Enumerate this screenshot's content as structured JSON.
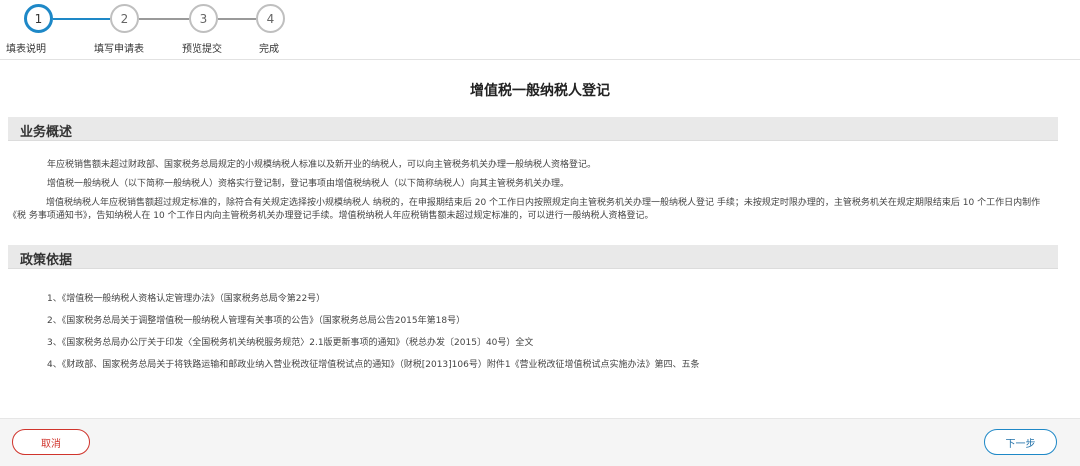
{
  "stepper": {
    "steps": [
      {
        "number": "1",
        "label": "填表说明"
      },
      {
        "number": "2",
        "label": "填写申请表"
      },
      {
        "number": "3",
        "label": "预览提交"
      },
      {
        "number": "4",
        "label": "完成"
      }
    ],
    "active_step": 1
  },
  "page": {
    "title": "增值税一般纳税人登记"
  },
  "overview": {
    "heading": "业务概述",
    "paragraphs": [
      "年应税销售额未超过财政部、国家税务总局规定的小规模纳税人标准以及新开业的纳税人，可以向主管税务机关办理一般纳税人资格登记。",
      "增值税一般纳税人（以下简称一般纳税人）资格实行登记制，登记事项由增值税纳税人（以下简称纳税人）向其主管税务机关办理。",
      "增值税纳税人年应税销售额超过规定标准的，除符合有关规定选择按小规模纳税人 纳税的，在申报期结束后 20 个工作日内按照规定向主管税务机关办理一般纳税人登记 手续；未按规定时限办理的，主管税务机关在规定期限结束后 10 个工作日内制作《税 务事项通知书》，告知纳税人在 10 个工作日内向主管税务机关办理登记手续。增值税纳税人年应税销售额未超过规定标准的，可以进行一般纳税人资格登记。"
    ]
  },
  "policy": {
    "heading": "政策依据",
    "items": [
      "1、《增值税一般纳税人资格认定管理办法》（国家税务总局令第22号）",
      "2、《国家税务总局关于调整增值税一般纳税人管理有关事项的公告》（国家税务总局公告2015年第18号）",
      "3、《国家税务总局办公厅关于印发〈全国税务机关纳税服务规范〉2.1版更新事项的通知》（税总办发〔2015〕40号）全文",
      "4、《财政部、国家税务总局关于将铁路运输和邮政业纳入营业税改征增值税试点的通知》（财税[2013]106号）附件1《营业税改征增值税试点实施办法》第四、五条"
    ]
  },
  "footer": {
    "cancel_label": "取消",
    "next_label": "下一步"
  },
  "colors": {
    "accent": "#1e88c7",
    "cancel": "#d0342c",
    "section_bg": "#e9e9e9"
  }
}
